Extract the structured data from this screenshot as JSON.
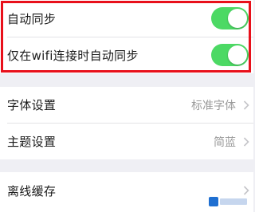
{
  "sync_section": {
    "auto_sync_label": "自动同步",
    "auto_sync_on": true,
    "wifi_sync_label": "仅在wifi连接时自动同步",
    "wifi_sync_on": true
  },
  "display_section": {
    "font_label": "字体设置",
    "font_value": "标准字体",
    "theme_label": "主题设置",
    "theme_value": "简蓝"
  },
  "offline_section": {
    "offline_label": "离线缓存"
  },
  "colors": {
    "toggle_on": "#4cd964",
    "highlight_border": "#e8101b",
    "background": "#efeff4"
  }
}
